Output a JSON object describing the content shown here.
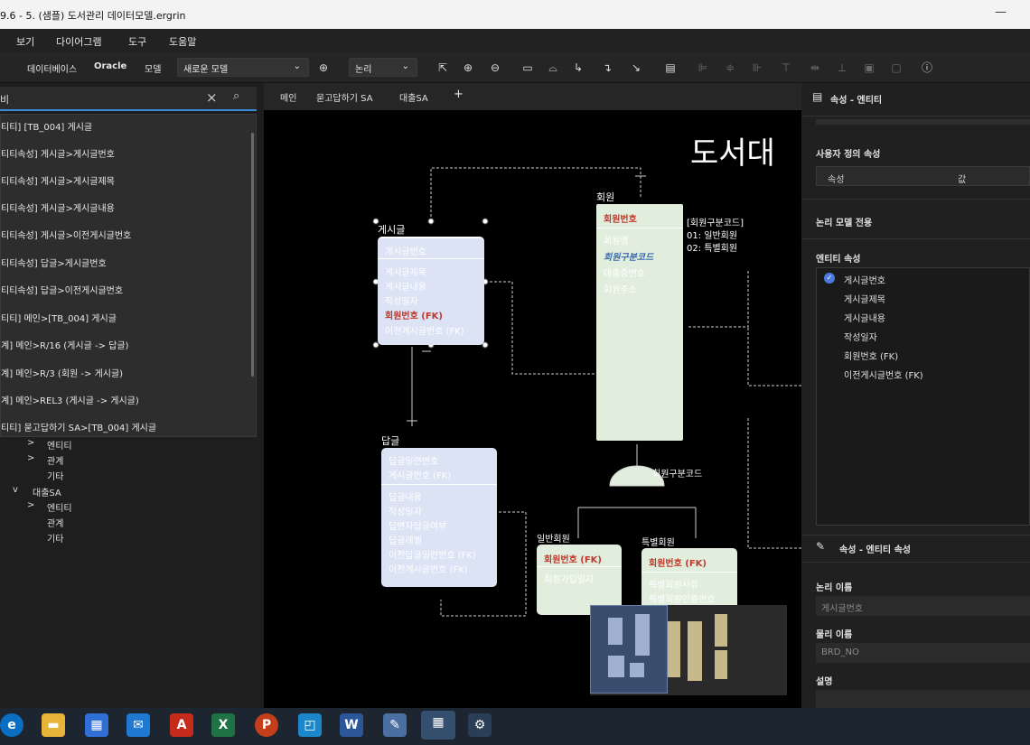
{
  "window": {
    "title": "9.6 - 5. (샘플) 도서관리 데이터모델.ergrin",
    "minimize": "—"
  },
  "menu": [
    "보기",
    "다이어그램",
    "도구",
    "도움말"
  ],
  "toolbar": {
    "db_label": "데이터베이스",
    "db_value": "Oracle",
    "model_label": "모델",
    "model_value": "새로운 모델",
    "view_value": "논리"
  },
  "search": {
    "value": "비",
    "clear": "×",
    "icon": "search-icon"
  },
  "results": [
    "티티] [TB_004] 게시글",
    "티티속성] 게시글>게시글번호",
    "티티속성] 게시글>게시글제목",
    "티티속성] 게시글>게시글내용",
    "티티속성] 게시글>이전게시글번호",
    "티티속성] 답글>게시글번호",
    "티티속성] 답글>이전게시글번호",
    "티티] 메인>[TB_004] 게시글",
    "계] 메인>R/16 (게시글 -> 답글)",
    "계] 메인>R/3 (회원 -> 게시글)",
    "계] 메인>REL3 (게시글 -> 게시글)",
    "티티] 묻고답하기 SA>[TB_004] 게시글"
  ],
  "tree": [
    {
      "label": "엔티티",
      "arrow": ">"
    },
    {
      "label": "관계",
      "arrow": ">"
    },
    {
      "label": "기타",
      "arrow": ""
    },
    {
      "label": "대출SA",
      "arrow": "v"
    },
    {
      "label": "엔티티",
      "arrow": ">"
    },
    {
      "label": "관계",
      "arrow": ""
    },
    {
      "label": "기타",
      "arrow": ""
    }
  ],
  "tabs": [
    "메인",
    "묻고답하기 SA",
    "대출SA",
    "+"
  ],
  "diagram": {
    "title": "도서대",
    "board": {
      "name": "게시글",
      "pk": [
        "게시글번호"
      ],
      "attrs": [
        "게시글제목",
        "게시글내용",
        "작성일자"
      ],
      "fk1": "회원번호 (FK)",
      "fk2": "이전게시글번호 (FK)"
    },
    "member": {
      "name": "회원",
      "pk": "회원번호",
      "attrs": [
        "회원명",
        "회원구분코드",
        "대출증번호",
        "회원주소"
      ],
      "note": [
        "[회원구분코드]",
        "01: 일반회원",
        "02: 특별회원"
      ]
    },
    "reply": {
      "name": "답글",
      "pk": [
        "답글일련번호",
        "게시글번호 (FK)"
      ],
      "attrs": [
        "답글내용",
        "작성일자",
        "답변자답글여부",
        "답글레벨",
        "이전답글일련번호 (FK)",
        "이전게시글번호 (FK)"
      ]
    },
    "subtype_label": "회원구분코드",
    "normal": {
      "name": "일반회원",
      "fk": "회원번호 (FK)",
      "attrs": [
        "회원가입일자"
      ]
    },
    "special": {
      "name": "특별회원",
      "fk": "회원번호 (FK)",
      "attrs": [
        "특별회원사유",
        "특별회원인증번호"
      ]
    }
  },
  "panel": {
    "header": "속성 - 엔티티",
    "custom_section": "사용자 정의 속성",
    "col_attr": "속성",
    "col_val": "값",
    "logical_only": "논리 모델 전용",
    "entity_attrs_title": "엔티티 속성",
    "entity_attrs": [
      "게시글번호",
      "게시글제목",
      "게시글내용",
      "작성일자",
      "회원번호 (FK)",
      "이전게시글번호 (FK)"
    ],
    "attr_header": "속성 - 엔티티 속성",
    "logical_name_label": "논리 이름",
    "logical_name": "게시글번호",
    "physical_name_label": "물리 이름",
    "physical_name": "BRD_NO",
    "desc_label": "설명"
  },
  "colors": {
    "accent": "#3a8be0",
    "pk_red": "#c0392b",
    "board_fill": "#dbe3f4",
    "member_fill": "#e2eedd"
  }
}
